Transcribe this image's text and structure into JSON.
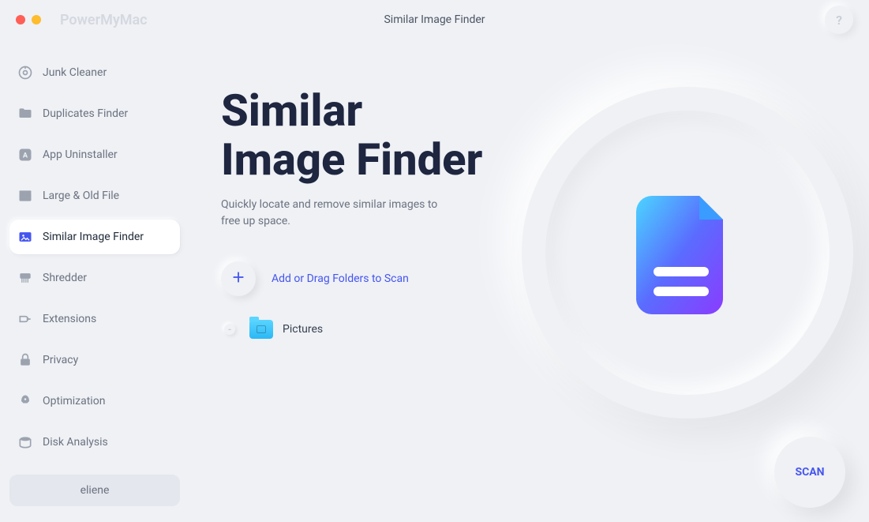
{
  "app": {
    "name": "PowerMyMac",
    "header_title": "Similar Image Finder",
    "help_symbol": "?"
  },
  "sidebar": {
    "items": [
      {
        "label": "Junk Cleaner",
        "icon": "junk"
      },
      {
        "label": "Duplicates Finder",
        "icon": "duplicates"
      },
      {
        "label": "App Uninstaller",
        "icon": "uninstaller"
      },
      {
        "label": "Large & Old File",
        "icon": "largeold"
      },
      {
        "label": "Similar Image Finder",
        "icon": "image",
        "active": true
      },
      {
        "label": "Shredder",
        "icon": "shredder"
      },
      {
        "label": "Extensions",
        "icon": "extensions"
      },
      {
        "label": "Privacy",
        "icon": "privacy"
      },
      {
        "label": "Optimization",
        "icon": "optimization"
      },
      {
        "label": "Disk Analysis",
        "icon": "disk"
      }
    ],
    "user": "eliene"
  },
  "main": {
    "title": "Similar\nImage Finder",
    "subtitle": "Quickly locate and remove similar images to free up space.",
    "add_label": "Add or Drag Folders to Scan",
    "folders": [
      {
        "name": "Pictures"
      }
    ],
    "scan_label": "SCAN"
  },
  "colors": {
    "accent": "#4555f0",
    "text_dark": "#1e2640",
    "text_muted": "#6b7280"
  }
}
